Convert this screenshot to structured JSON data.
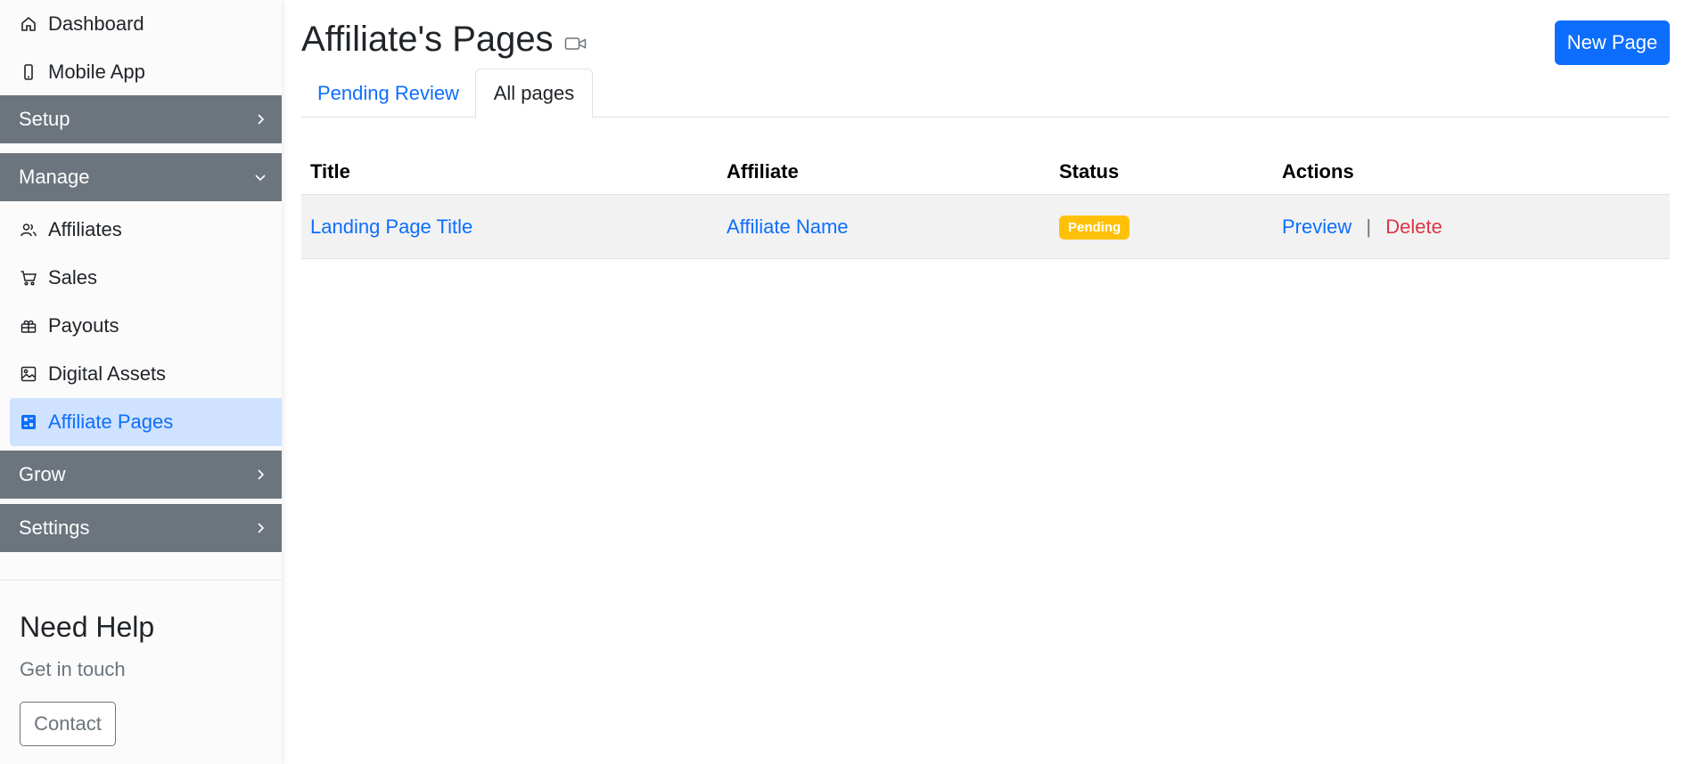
{
  "sidebar": {
    "top_items": [
      {
        "label": "Dashboard",
        "icon": "home-icon"
      },
      {
        "label": "Mobile App",
        "icon": "phone-icon"
      }
    ],
    "sections": {
      "setup": {
        "label": "Setup",
        "chevron": "chevron-right-icon"
      },
      "manage": {
        "label": "Manage",
        "chevron": "chevron-down-icon"
      },
      "grow": {
        "label": "Grow",
        "chevron": "chevron-right-icon"
      },
      "settings": {
        "label": "Settings",
        "chevron": "chevron-right-icon"
      }
    },
    "manage_items": [
      {
        "label": "Affiliates",
        "icon": "users-icon"
      },
      {
        "label": "Sales",
        "icon": "cart-icon"
      },
      {
        "label": "Payouts",
        "icon": "gift-icon"
      },
      {
        "label": "Digital Assets",
        "icon": "image-icon"
      },
      {
        "label": "Affiliate Pages",
        "icon": "pages-icon",
        "active": true
      }
    ],
    "help": {
      "title": "Need Help",
      "subtitle": "Get in touch",
      "contact_label": "Contact"
    }
  },
  "main": {
    "title": "Affiliate's Pages",
    "title_icon": "video-camera-icon",
    "new_page_label": "New Page",
    "tabs": [
      {
        "label": "Pending Review",
        "active": false
      },
      {
        "label": "All pages",
        "active": true
      }
    ],
    "table": {
      "headers": [
        "Title",
        "Affiliate",
        "Status",
        "Actions"
      ],
      "rows": [
        {
          "title": "Landing Page Title",
          "affiliate": "Affiliate Name",
          "status": "Pending",
          "actions": {
            "preview": "Preview",
            "separator": "|",
            "delete": "Delete"
          }
        }
      ]
    }
  },
  "colors": {
    "primary": "#0d6efd",
    "danger": "#dc3545",
    "warning": "#ffc107",
    "section_header": "#6c757d",
    "active_item_bg": "#cfe2ff"
  }
}
